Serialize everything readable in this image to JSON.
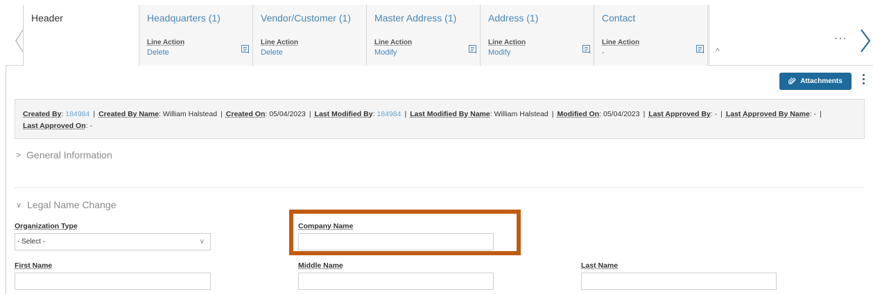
{
  "tabs": [
    {
      "title": "Header",
      "line_action": "",
      "value": "",
      "active": true
    },
    {
      "title": "Headquarters (1)",
      "line_action": "Line Action",
      "value": "Delete"
    },
    {
      "title": "Vendor/Customer (1)",
      "line_action": "Line Action",
      "value": "Delete"
    },
    {
      "title": "Master Address (1)",
      "line_action": "Line Action",
      "value": "Modify"
    },
    {
      "title": "Address (1)",
      "line_action": "Line Action",
      "value": "Modify"
    },
    {
      "title": "Contact",
      "line_action": "Line Action",
      "value": "-"
    }
  ],
  "more_label": "···",
  "attachments_label": "Attachments",
  "audit": {
    "created_by_label": "Created By",
    "created_by": "184984",
    "created_by_name_label": "Created By Name",
    "created_by_name": "William Halstead",
    "created_on_label": "Created On",
    "created_on": "05/04/2023",
    "last_modified_by_label": "Last Modified By",
    "last_modified_by": "184984",
    "last_modified_by_name_label": "Last Modified By Name",
    "last_modified_by_name": "William Halstead",
    "modified_on_label": "Modified On",
    "modified_on": "05/04/2023",
    "last_approved_by_label": "Last Approved By",
    "last_approved_by": "-",
    "last_approved_by_name_label": "Last Approved By Name",
    "last_approved_by_name": "-",
    "last_approved_on_label": "Last Approved On",
    "last_approved_on": "-"
  },
  "sections": {
    "general": "General Information",
    "legal": "Legal Name Change"
  },
  "form": {
    "org_type_label": "Organization Type",
    "org_type_value": "- Select -",
    "company_name_label": "Company Name",
    "company_name_value": "",
    "first_name_label": "First Name",
    "middle_name_label": "Middle Name",
    "last_name_label": "Last Name"
  },
  "colors": {
    "accent": "#1e6a9a",
    "link": "#4a86b5",
    "highlight": "#c15b12"
  }
}
